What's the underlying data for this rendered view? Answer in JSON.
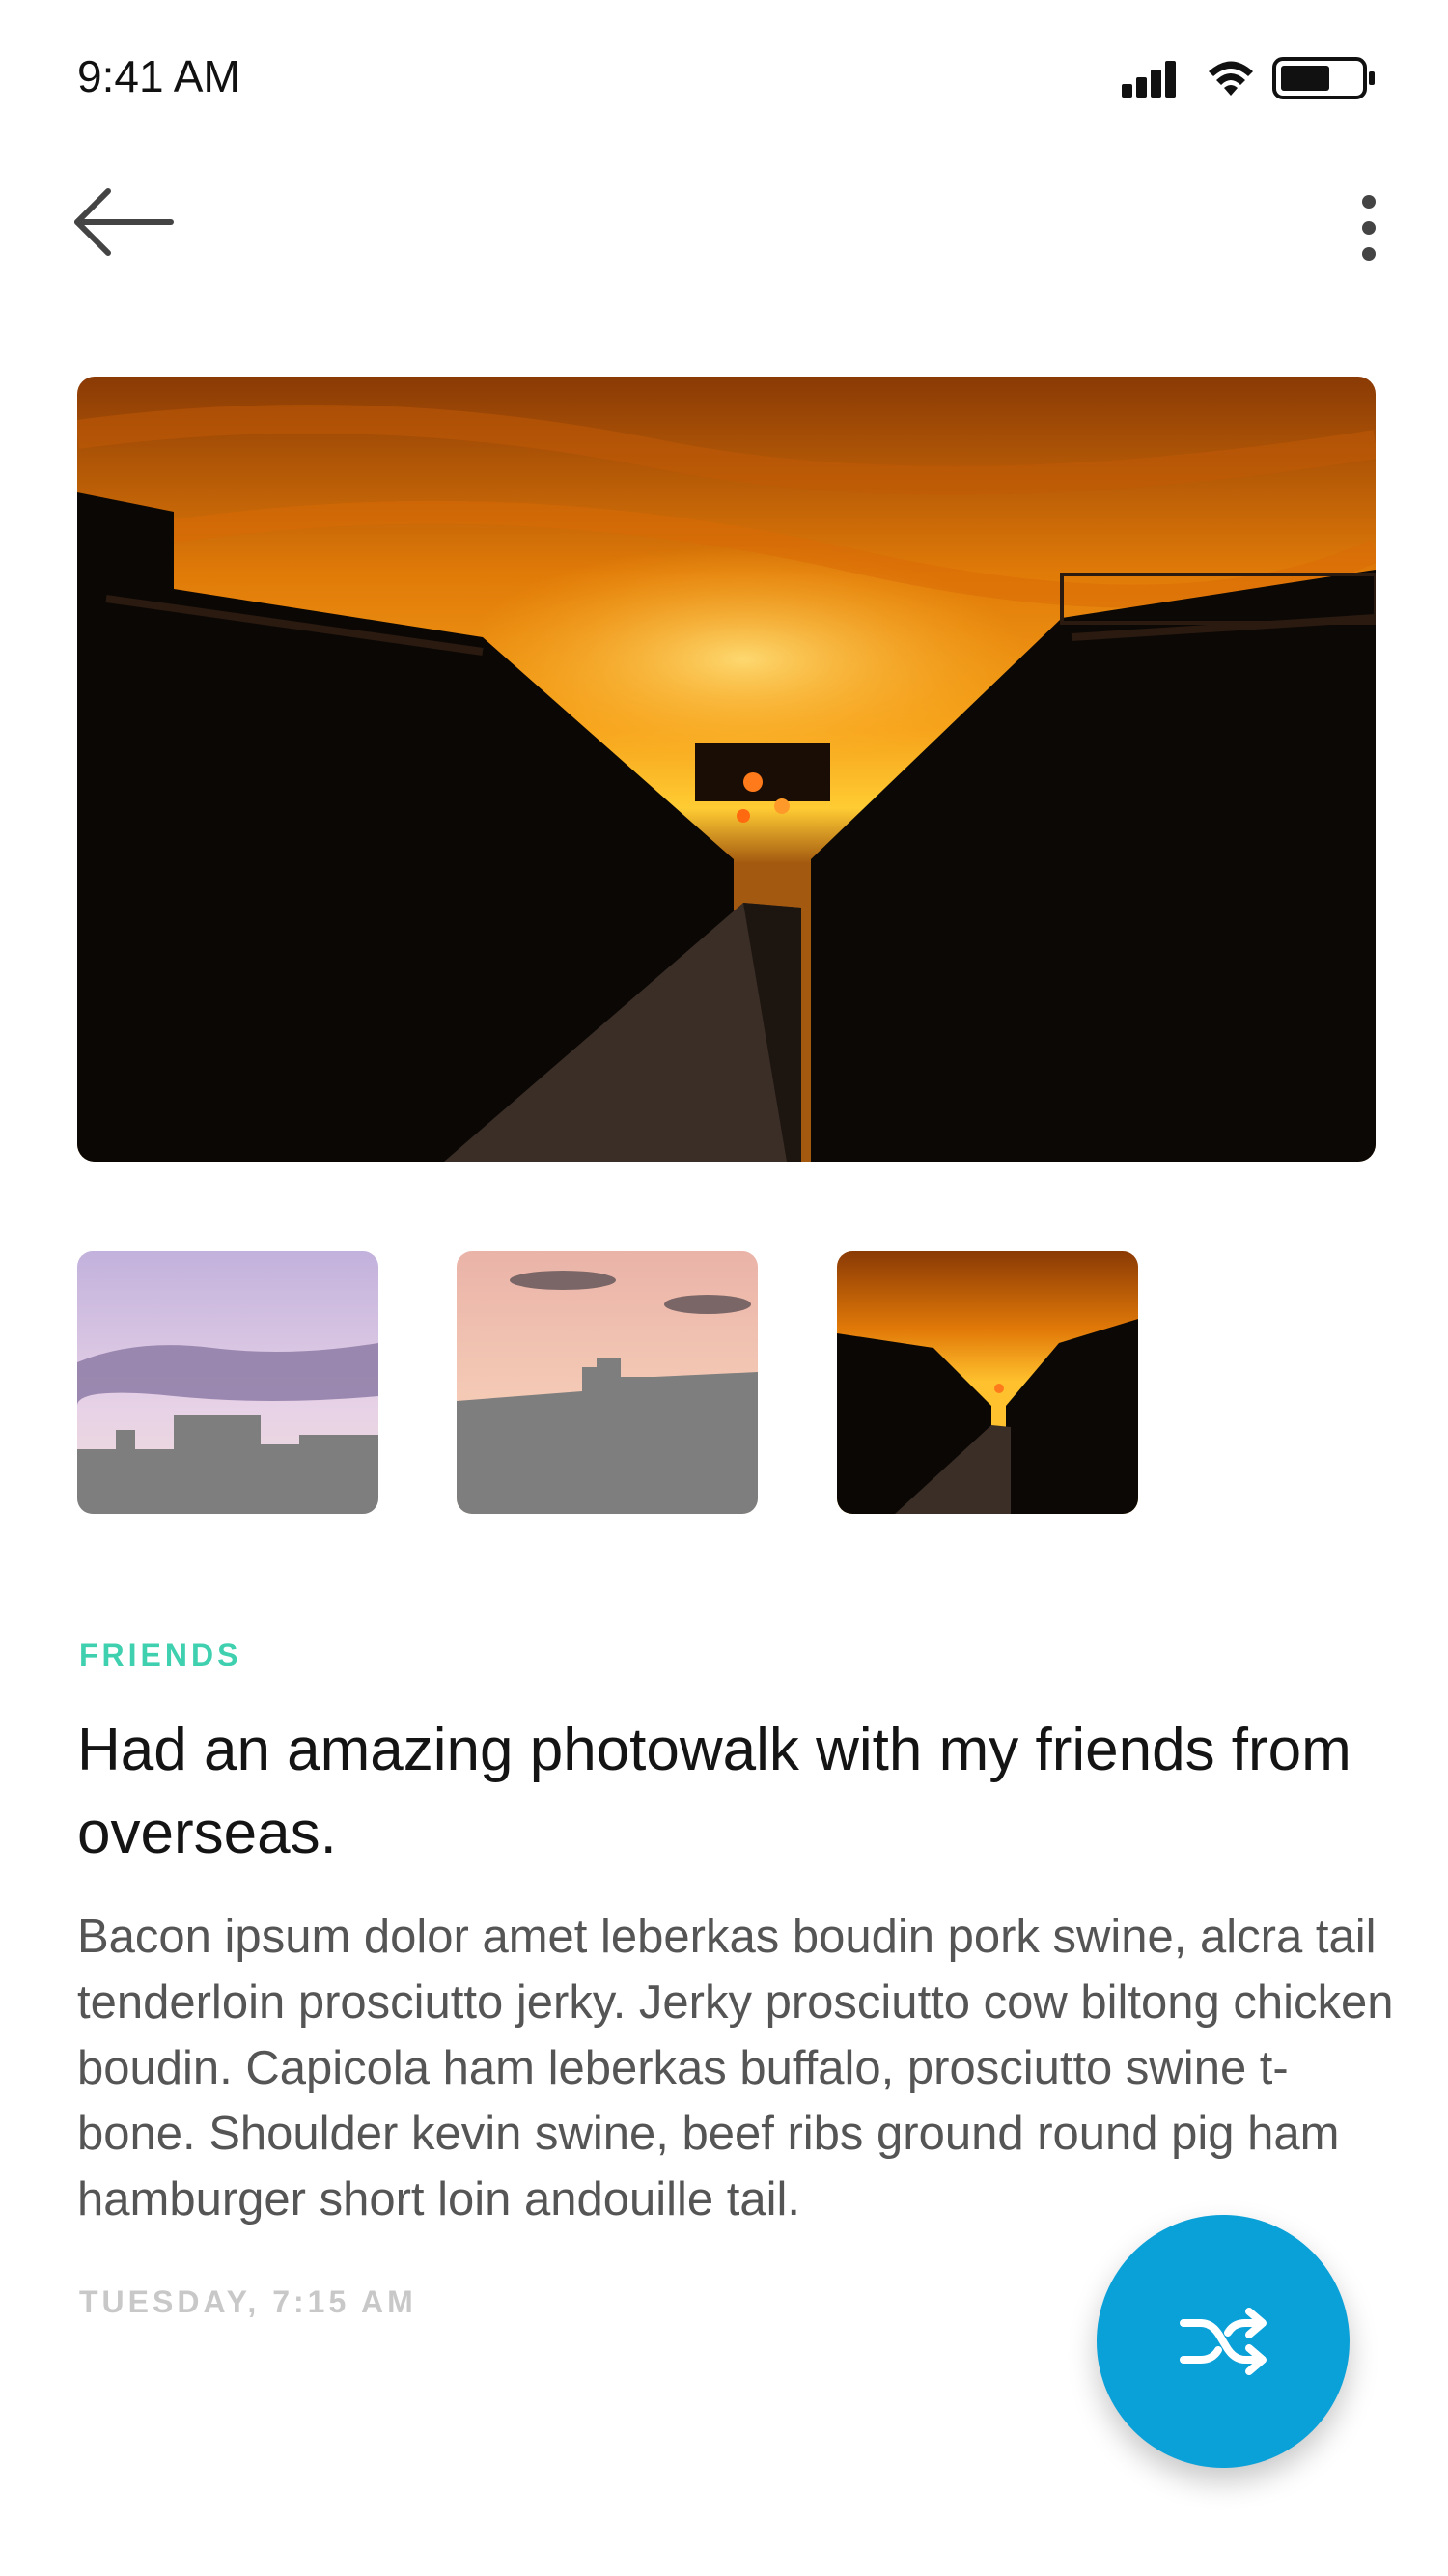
{
  "status_bar": {
    "time": "9:41 AM",
    "icons": [
      "signal-icon",
      "wifi-icon",
      "battery-icon"
    ]
  },
  "nav": {
    "back_icon": "back-arrow-icon",
    "more_icon": "more-vertical-icon"
  },
  "gallery": {
    "hero": "rooftop sunset photo",
    "thumbnails": [
      {
        "name": "purple skyline thumbnail"
      },
      {
        "name": "peach skyline thumbnail"
      },
      {
        "name": "sunset rooftop thumbnail",
        "selected": true
      }
    ]
  },
  "post": {
    "category": "FRIENDS",
    "title": "Had an amazing photowalk with my friends from overseas.",
    "body": "Bacon ipsum dolor amet leberkas boudin pork swine, alcra tail tenderloin prosciutto jerky. Jerky prosciutto cow biltong chicken boudin. Capicola ham leberkas buffalo, prosciutto swine t-bone. Shoulder kevin swine, beef ribs ground round pig ham hamburger short loin andouille tail.",
    "timestamp": "TUESDAY, 7:15 AM"
  },
  "fab": {
    "icon": "shuffle-icon"
  },
  "colors": {
    "accent": "#0aa0d8",
    "category": "#3fd0b0",
    "timestamp": "#c8c8c8",
    "title": "#141414",
    "body": "#555555"
  }
}
